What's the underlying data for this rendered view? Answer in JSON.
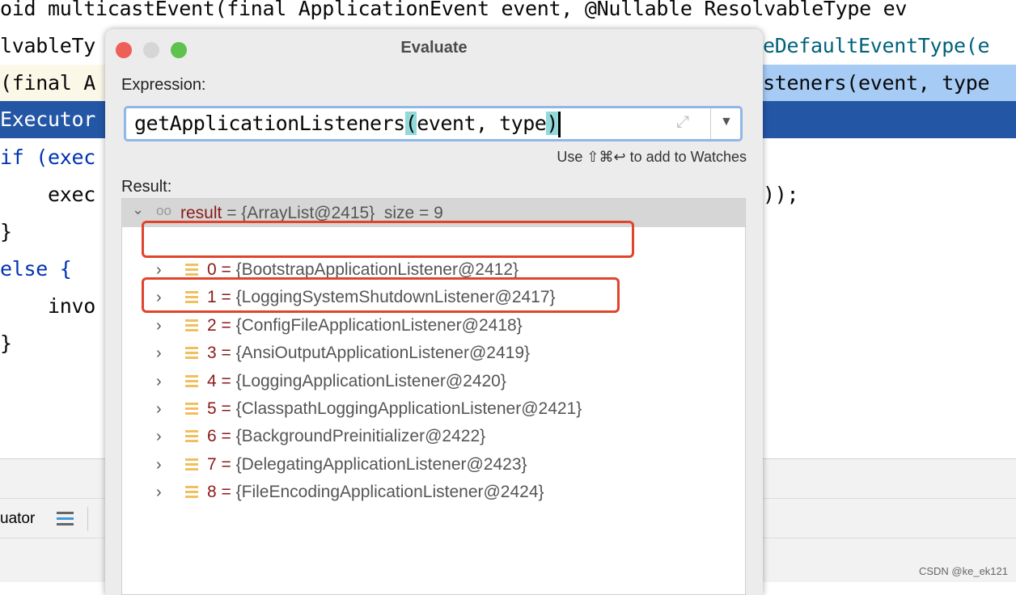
{
  "editor": {
    "lines": [
      {
        "left": "oid multicastEvent(final ApplicationEvent event, @Nullable ResolvableType ev"
      },
      {
        "left": "lvableTy",
        "right": "eDefaultEventType(e"
      },
      {
        "left": "(final A",
        "right": "steners(event, type"
      },
      {
        "left": "Executor"
      },
      {
        "left": "if (exec"
      },
      {
        "left": "    exec",
        "right": "));"
      },
      {
        "left": "}"
      },
      {
        "left": "else {"
      },
      {
        "left": "    invo"
      },
      {
        "left": "}"
      }
    ]
  },
  "bottom_panel": {
    "tab_label": "uator"
  },
  "dialog": {
    "title": "Evaluate",
    "expression_label": "Expression:",
    "expression": {
      "before": "getApplicationListeners",
      "p1": "(",
      "mid": "event, type",
      "p2": ")"
    },
    "hint": "Use ⇧⌘↩ to add to Watches",
    "result_label": "Result:",
    "result": {
      "name": "result",
      "value": " = {ArrayList@2415}  size = 9"
    },
    "items": [
      {
        "index": "0",
        "value": "{BootstrapApplicationListener@2412}",
        "highlighted": true
      },
      {
        "index": "1",
        "value": "{LoggingSystemShutdownListener@2417}"
      },
      {
        "index": "2",
        "value": "{ConfigFileApplicationListener@2418}",
        "highlighted": true
      },
      {
        "index": "3",
        "value": "{AnsiOutputApplicationListener@2419}"
      },
      {
        "index": "4",
        "value": "{LoggingApplicationListener@2420}"
      },
      {
        "index": "5",
        "value": "{ClasspathLoggingApplicationListener@2421}"
      },
      {
        "index": "6",
        "value": "{BackgroundPreinitializer@2422}"
      },
      {
        "index": "7",
        "value": "{DelegatingApplicationListener@2423}"
      },
      {
        "index": "8",
        "value": "{FileEncodingApplicationListener@2424}"
      }
    ]
  },
  "watermark": "CSDN @ke_ek121"
}
